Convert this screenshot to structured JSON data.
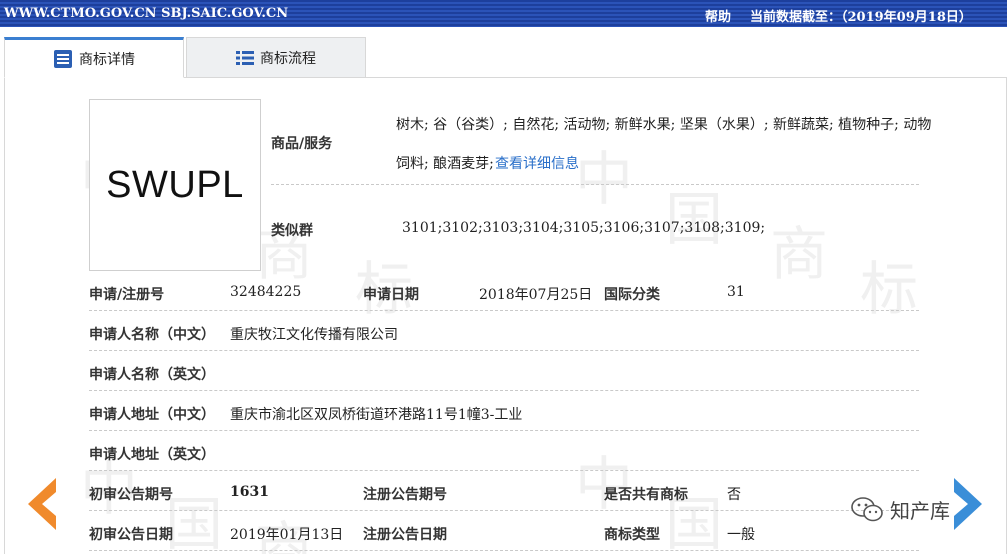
{
  "topbar": {
    "site": "WWW.CTMO.GOV.CN SBJ.SAIC.GOV.CN",
    "help": "帮助",
    "as_of": "当前数据截至：（2019年09月18日）"
  },
  "tabs": [
    {
      "label": "商标详情",
      "icon": "detail-list-icon"
    },
    {
      "label": "商标流程",
      "icon": "flow-list-icon"
    }
  ],
  "watermark": {
    "chars": [
      "中",
      "国",
      "商",
      "标"
    ]
  },
  "trademark": {
    "logo_text": "SWUPL",
    "goods_label": "商品/服务",
    "goods_value": "树木; 谷（谷类）; 自然花; 活动物; 新鲜水果; 坚果（水果）; 新鲜蔬菜; 植物种子; 动物",
    "goods_value_line2": "饲料; 酿酒麦芽;",
    "goods_link": "查看详细信息",
    "similar_label": "类似群",
    "similar_value": "3101;3102;3103;3104;3105;3106;3107;3108;3109;"
  },
  "rows": {
    "reg_no_label": "申请/注册号",
    "reg_no": "32484225",
    "app_date_label": "申请日期",
    "app_date": "2018年07月25日",
    "intl_class_label": "国际分类",
    "intl_class": "31",
    "applicant_cn_label": "申请人名称（中文）",
    "applicant_cn": "重庆牧江文化传播有限公司",
    "applicant_en_label": "申请人名称（英文）",
    "applicant_en": "",
    "address_cn_label": "申请人地址（中文）",
    "address_cn": "重庆市渝北区双凤桥街道环港路11号1幢3-工业",
    "address_en_label": "申请人地址（英文）",
    "address_en": "",
    "prelim_issue_label": "初审公告期号",
    "prelim_issue": "1631",
    "reg_issue_label": "注册公告期号",
    "reg_issue": "",
    "shared_label": "是否共有商标",
    "shared": "否",
    "prelim_date_label": "初审公告日期",
    "prelim_date": "2019年01月13日",
    "reg_date_label": "注册公告日期",
    "reg_date": "",
    "tm_type_label": "商标类型",
    "tm_type": "一般"
  },
  "footer": {
    "brand": "知产库"
  },
  "colors": {
    "topbar": "#1d3f9c",
    "accent": "#3b7fd1",
    "arrow": "#f08a2c",
    "link": "#2a6fc9"
  }
}
